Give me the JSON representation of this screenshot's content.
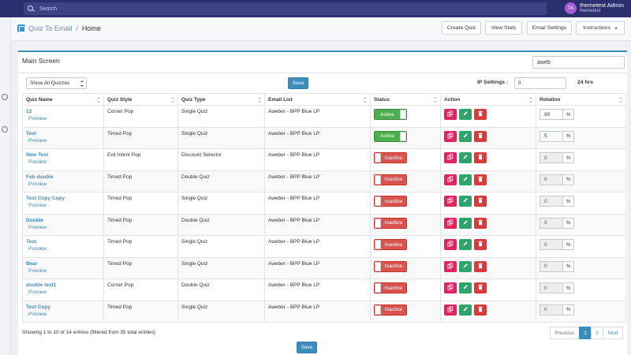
{
  "topbar": {
    "search_placeholder": "Search",
    "user_initials": "TA",
    "user_name": "themetest Admin",
    "user_sub": "themetest"
  },
  "header": {
    "app_name": "Quiz To Email",
    "separator": "/",
    "page": "Home",
    "buttons": {
      "create_quiz": "Create Quiz",
      "view_stats": "View Stats",
      "email_settings": "Email Settings",
      "instructions": "Instructions"
    }
  },
  "panel": {
    "title": "Main Screen",
    "search_value": "aweb",
    "filter_select": "Show All Quizzes",
    "save_label": "Save",
    "ip_label": "IP Settings :",
    "ip_value": "0",
    "hrs_label": "24 hrs"
  },
  "table": {
    "columns": [
      "Quiz Name",
      "Quiz Style",
      "Quiz Type",
      "Email List",
      "Status",
      "Action",
      "Rotation"
    ],
    "preview_label": "Preview",
    "rows": [
      {
        "name": "12",
        "style": "Corner Pop",
        "type": "Single Quiz",
        "email": "Aweber - BPP Blue LP",
        "status": "Active",
        "rotation": "90"
      },
      {
        "name": "Test",
        "style": "Timed Pop",
        "type": "Single Quiz",
        "email": "Aweber - BPP Blue LP",
        "status": "Active",
        "rotation": "5"
      },
      {
        "name": "New Test",
        "style": "Exit Intent Pop",
        "type": "Discount Selector",
        "email": "Aweber - BPP Blue LP",
        "status": "Inactive",
        "rotation": "0"
      },
      {
        "name": "Feb double",
        "style": "Timed Pop",
        "type": "Double Quiz",
        "email": "Aweber - BPP Blue LP",
        "status": "Inactive",
        "rotation": "0"
      },
      {
        "name": "Test Copy Copy",
        "style": "Timed Pop",
        "type": "Single Quiz",
        "email": "Aweber - BPP Blue LP",
        "status": "Inactive",
        "rotation": "0"
      },
      {
        "name": "Double",
        "style": "Timed Pop",
        "type": "Double Quiz",
        "email": "Aweber - BPP Blue LP",
        "status": "Inactive",
        "rotation": "0"
      },
      {
        "name": "Test",
        "style": "Timed Pop",
        "type": "Single Quiz",
        "email": "Aweber - BPP Blue LP",
        "status": "Inactive",
        "rotation": "0"
      },
      {
        "name": "Bear",
        "style": "Timed Pop",
        "type": "Single Quiz",
        "email": "Aweber - BPP Blue LP",
        "status": "Inactive",
        "rotation": "0"
      },
      {
        "name": "double test1",
        "style": "Corner Pop",
        "type": "Double Quiz",
        "email": "Aweber - BPP Blue LP",
        "status": "Inactive",
        "rotation": "0"
      },
      {
        "name": "Test Copy",
        "style": "Timed Pop",
        "type": "Single Quiz",
        "email": "Aweber - BPP Blue LP",
        "status": "Inactive",
        "rotation": "0"
      }
    ],
    "percent": "%"
  },
  "footer": {
    "info": "Showing 1 to 10 of 14 entries (filtered from 35 total entries)",
    "pagination": {
      "previous": "Previous",
      "page1": "1",
      "page2": "2",
      "next": "Next"
    },
    "save_label": "Save"
  },
  "colors": {
    "topbar": "#2b2f6e",
    "primary": "#3c8dbc",
    "active": "#4cae4c",
    "inactive": "#d9534f",
    "copy": "#e0245e",
    "edit": "#2fa36a",
    "delete": "#d73c3c"
  }
}
